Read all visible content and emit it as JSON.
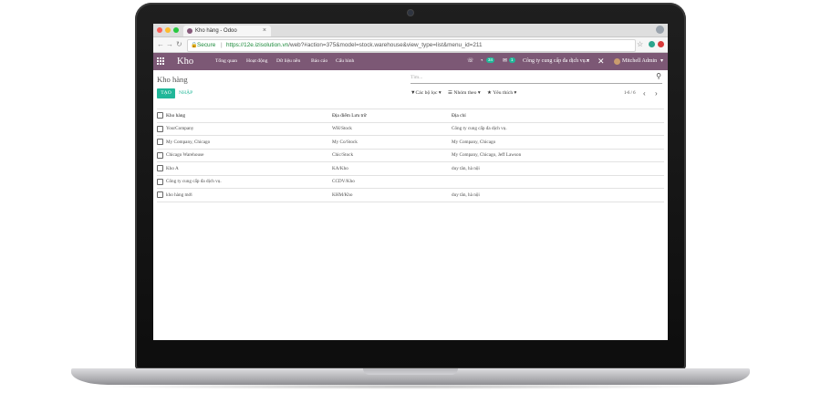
{
  "browser": {
    "tab_title": "Kho hàng - Odoo",
    "tab_close": "×",
    "secure_label": "Secure",
    "url_host": "https://12e.izisolution.vn",
    "url_path": "/web?#action=375&model=stock.warehouse&view_type=list&menu_id=211"
  },
  "navbar": {
    "app_name": "Kho",
    "menu": [
      "Tổng quan",
      "Hoạt động",
      "Dữ liệu nền",
      "Báo cáo",
      "Cấu hình"
    ],
    "messages_count": "34",
    "activity_count": "1",
    "company": "Công ty cung cấp đa dịch vụ...",
    "user": "Mitchell Admin"
  },
  "control_panel": {
    "title": "Kho hàng",
    "search_placeholder": "Tìm...",
    "create_label": "TẠO",
    "import_label": "NHẬP",
    "filters_label": "Các bộ lọc",
    "group_by_label": "Nhóm theo",
    "favorites_label": "Yêu thích",
    "pager": "1-6 / 6"
  },
  "list": {
    "columns": [
      "Kho hàng",
      "Địa điểm Lưu trữ",
      "Địa chỉ"
    ],
    "rows": [
      [
        "YourCompany",
        "WH/Stock",
        "Công ty cung cấp đa dịch vụ."
      ],
      [
        "My Company, Chicago",
        "My Co/Stock",
        "My Company, Chicago"
      ],
      [
        "Chicago Warehouse",
        "Chic/Stock",
        "My Company, Chicago, Jeff Lawson"
      ],
      [
        "Kho A",
        "KA/Kho",
        "duy tân, hà nội"
      ],
      [
        "Công ty cung cấp đa dịch vụ.",
        "CCDV/Kho",
        ""
      ],
      [
        "kho hàng mới",
        "KHM/Kho",
        "duy tân, hà nội"
      ]
    ]
  },
  "colors": {
    "navbar": "#7c5875",
    "primary_button": "#21b799"
  }
}
